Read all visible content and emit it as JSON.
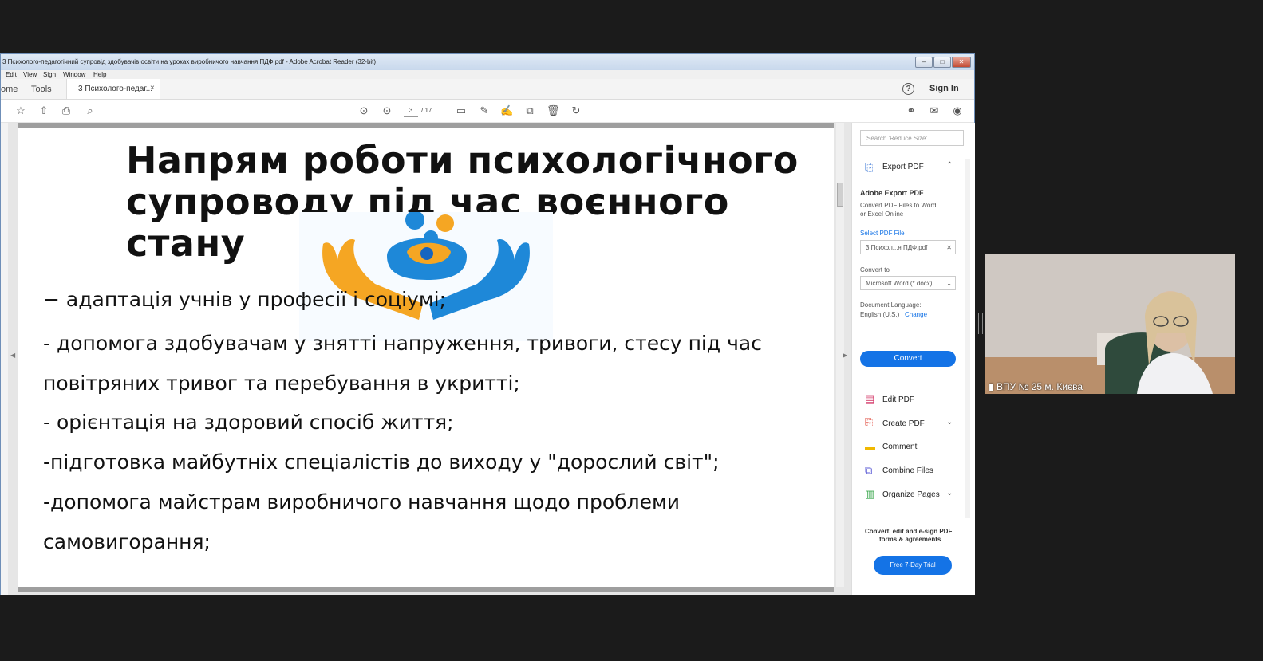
{
  "window": {
    "title": "3 Психолого-педагогічний супровід здобувачів освіти на уроках виробничого навчання ПДФ.pdf - Adobe Acrobat Reader (32-bit)",
    "menu": [
      "Edit",
      "View",
      "Sign",
      "Window",
      "Help"
    ]
  },
  "tabs": {
    "home": "ome",
    "tools": "Tools",
    "doc": "3 Психолого-педаг...",
    "close": "×",
    "help": "?",
    "sign_in": "Sign In"
  },
  "toolbar": {
    "page_current": "3",
    "page_total": "/ 17"
  },
  "slide": {
    "title_line1": "Напрям роботи психологічного",
    "title_line2": "супроводу під час воєнного",
    "title_line3": "стану",
    "bullets": [
      "− адаптація учнів у професії і соціумі;",
      "- допомога здобувачам у знятті напруження, тривоги, стесу під час",
      "повітряних тривог та перебування в укритті;",
      "- орієнтація на здоровий спосіб життя;",
      "-підготовка майбутніх спеціалістів до виходу у \"дорослий світ\";",
      "-допомога майстрам виробничого навчання щодо проблеми",
      "самовигорання;"
    ]
  },
  "rightpane": {
    "search_placeholder": "Search 'Reduce Size'",
    "export_pdf": "Export PDF",
    "adobe_export": "Adobe Export PDF",
    "export_desc1": "Convert PDF Files to Word",
    "export_desc2": "or Excel Online",
    "select_pdf": "Select PDF File",
    "file_name": "3 Психол...я ПДФ.pdf",
    "convert_to": "Convert to",
    "format": "Microsoft Word (*.docx)",
    "doc_lang": "Document Language:",
    "lang": "English (U.S.)",
    "change": "Change",
    "convert": "Convert",
    "tools": [
      "Edit PDF",
      "Create PDF",
      "Comment",
      "Combine Files",
      "Organize Pages"
    ],
    "promo1": "Convert, edit and e-sign PDF",
    "promo2": "forms & agreements",
    "trial": "Free 7-Day Trial"
  },
  "video": {
    "name": "ВПУ № 25 м. Києва"
  },
  "colors": {
    "accent": "#1473e6",
    "logo_yellow": "#f5a623",
    "logo_blue": "#1e88d8"
  }
}
